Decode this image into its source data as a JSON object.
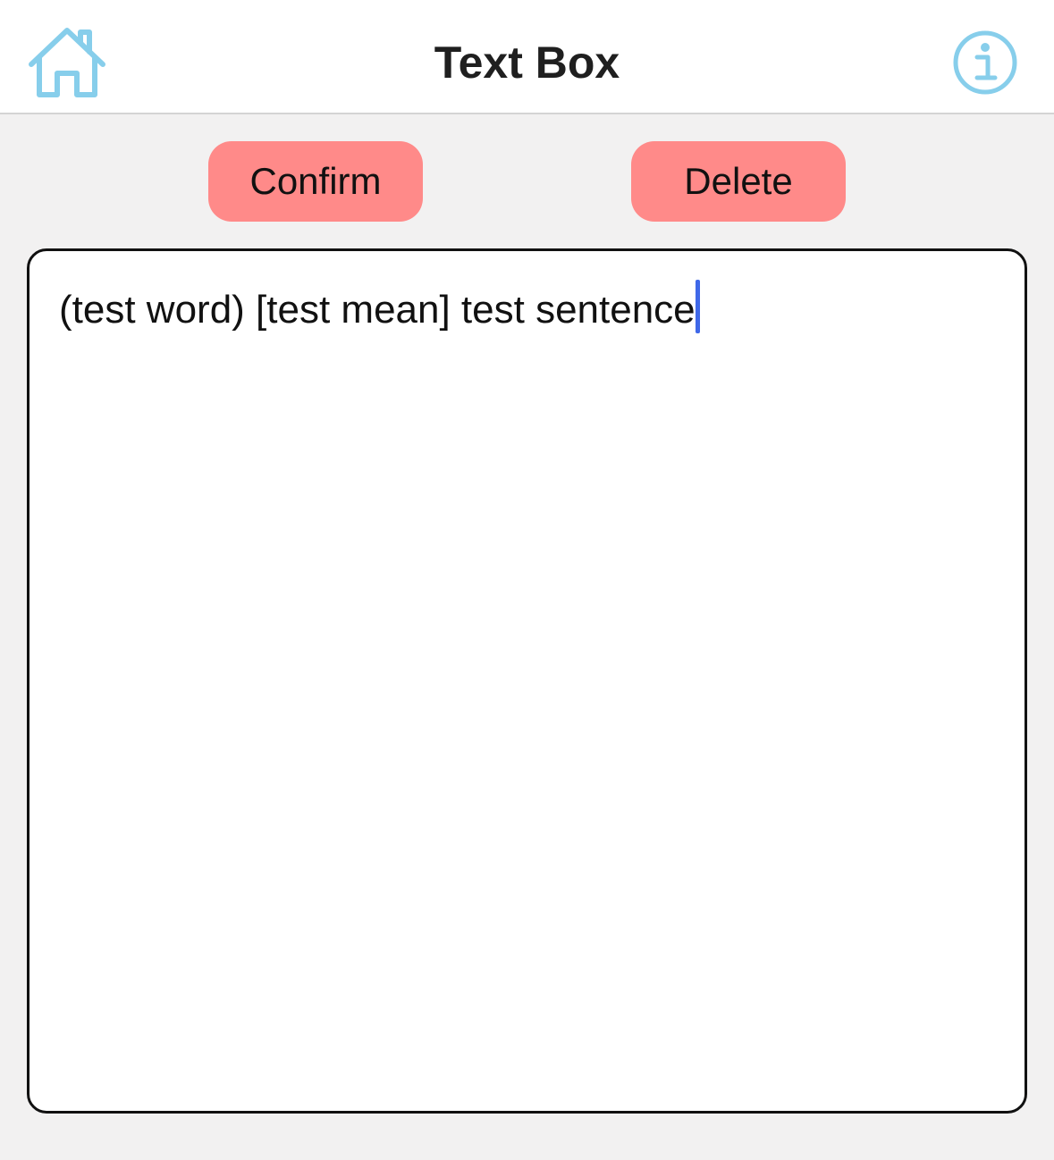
{
  "header": {
    "title": "Text Box",
    "home_icon": "home-icon",
    "info_icon": "info-icon",
    "icon_color": "#87ceeb"
  },
  "actions": {
    "confirm_label": "Confirm",
    "delete_label": "Delete",
    "button_color": "#ff8a89"
  },
  "editor": {
    "value": "(test word) [test mean] test sentence",
    "caret_color": "#3f68e8"
  }
}
